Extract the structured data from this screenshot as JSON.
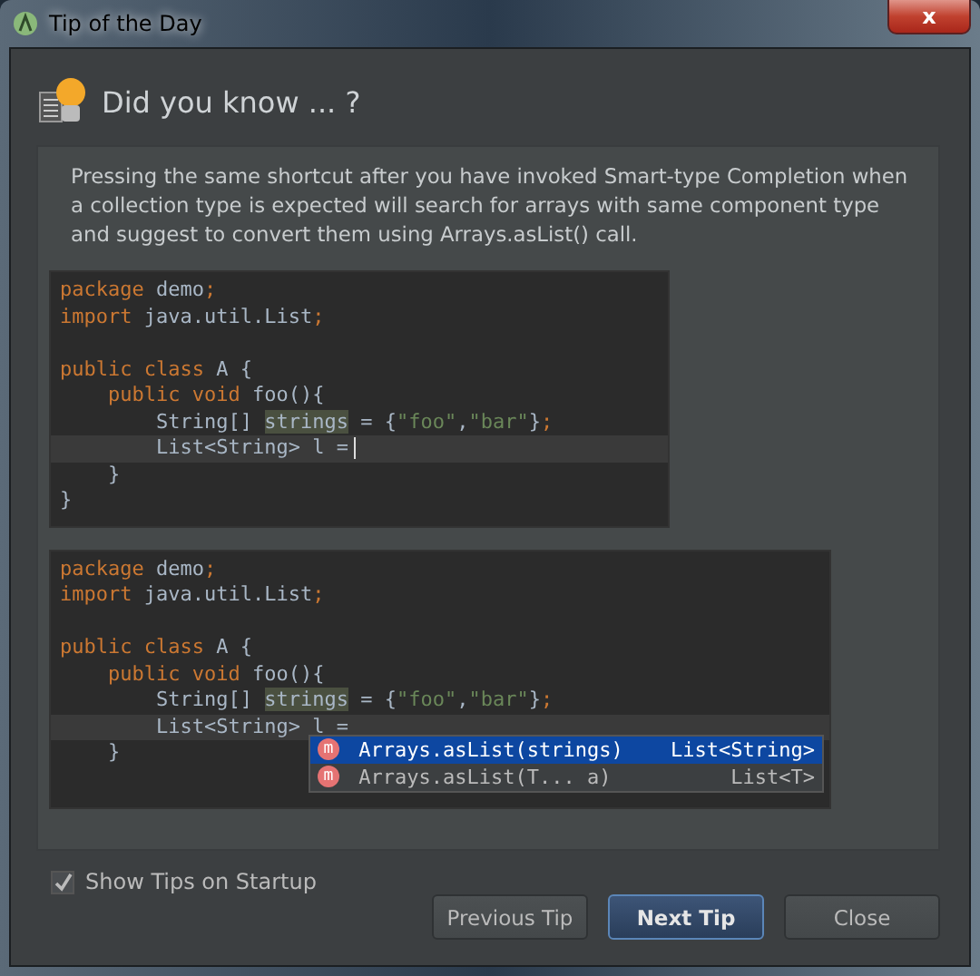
{
  "window": {
    "title": "Tip of the Day",
    "close_label": "x"
  },
  "heading": "Did you know ... ?",
  "tip_text": "Pressing the same shortcut after you have invoked Smart-type Completion when a collection type is expected will search for arrays with same component type and suggest to convert them using Arrays.asList() call.",
  "snippets": [
    {
      "lines": [
        {
          "current": false,
          "tokens": [
            {
              "kind": "keyword",
              "t": "package"
            },
            {
              "kind": "plain",
              "t": " demo"
            },
            {
              "kind": "keyword",
              "t": ";"
            }
          ]
        },
        {
          "current": false,
          "tokens": [
            {
              "kind": "keyword",
              "t": "import"
            },
            {
              "kind": "plain",
              "t": " java.util.List"
            },
            {
              "kind": "keyword",
              "t": ";"
            }
          ]
        },
        {
          "current": false
        },
        {
          "current": false,
          "tokens": [
            {
              "kind": "keyword",
              "t": "public class "
            },
            {
              "kind": "plain",
              "t": "A {"
            }
          ]
        },
        {
          "current": false,
          "tokens": [
            {
              "kind": "keyword",
              "t": "    public void "
            },
            {
              "kind": "plain",
              "t": "foo(){"
            }
          ]
        },
        {
          "current": false,
          "tokens": [
            {
              "kind": "plain",
              "t": "        String[] "
            },
            {
              "kind": "highlight",
              "t": "strings"
            },
            {
              "kind": "plain",
              "t": " = {"
            },
            {
              "kind": "string",
              "t": "\"foo\""
            },
            {
              "kind": "plain",
              "t": ","
            },
            {
              "kind": "string",
              "t": "\"bar\""
            },
            {
              "kind": "plain",
              "t": "}"
            },
            {
              "kind": "keyword",
              "t": ";"
            }
          ]
        },
        {
          "current": true,
          "tokens": [
            {
              "kind": "plain",
              "t": "        List<String> l ="
            }
          ]
        },
        {
          "current": false,
          "tokens": [
            {
              "kind": "plain",
              "t": "    }"
            }
          ]
        },
        {
          "current": false,
          "tokens": [
            {
              "kind": "plain",
              "t": "}"
            }
          ]
        }
      ]
    },
    {
      "lines": [
        {
          "current": false,
          "tokens": [
            {
              "kind": "keyword",
              "t": "package"
            },
            {
              "kind": "plain",
              "t": " demo"
            },
            {
              "kind": "keyword",
              "t": ";"
            }
          ]
        },
        {
          "current": false,
          "tokens": [
            {
              "kind": "keyword",
              "t": "import"
            },
            {
              "kind": "plain",
              "t": " java.util.List"
            },
            {
              "kind": "keyword",
              "t": ";"
            }
          ]
        },
        {
          "current": false
        },
        {
          "current": false,
          "tokens": [
            {
              "kind": "keyword",
              "t": "public class "
            },
            {
              "kind": "plain",
              "t": "A {"
            }
          ]
        },
        {
          "current": false,
          "tokens": [
            {
              "kind": "keyword",
              "t": "    public void "
            },
            {
              "kind": "plain",
              "t": "foo(){"
            }
          ]
        },
        {
          "current": false,
          "tokens": [
            {
              "kind": "plain",
              "t": "        String[] "
            },
            {
              "kind": "highlight",
              "t": "strings"
            },
            {
              "kind": "plain",
              "t": " = {"
            },
            {
              "kind": "string",
              "t": "\"foo\""
            },
            {
              "kind": "plain",
              "t": ","
            },
            {
              "kind": "string",
              "t": "\"bar\""
            },
            {
              "kind": "plain",
              "t": "}"
            },
            {
              "kind": "keyword",
              "t": ";"
            }
          ]
        },
        {
          "current": true,
          "tokens": [
            {
              "kind": "plain",
              "t": "        List<String> l ="
            }
          ]
        },
        {
          "current": false,
          "tokens": [
            {
              "kind": "plain",
              "t": "    }"
            }
          ]
        }
      ],
      "completions": [
        {
          "icon": "m",
          "text": "Arrays.asList(strings)",
          "type": "List<String>",
          "selected": true
        },
        {
          "icon": "m",
          "text": "Arrays.asList(T... a)",
          "type": "List<T>",
          "selected": false
        }
      ]
    }
  ],
  "show_tips": {
    "label": "Show Tips on Startup",
    "checked": true
  },
  "buttons": [
    {
      "label": "Previous Tip",
      "default": false
    },
    {
      "label": "Next Tip",
      "default": true
    },
    {
      "label": "Close",
      "default": false
    }
  ]
}
